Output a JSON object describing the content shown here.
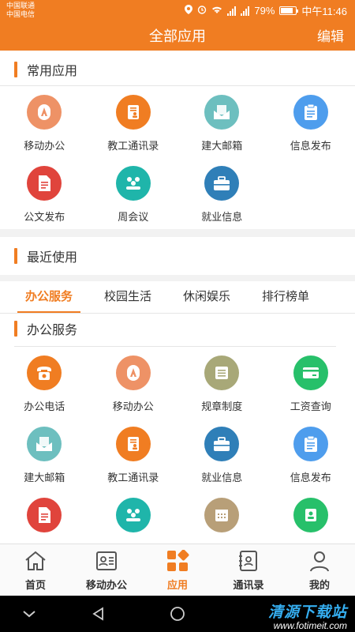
{
  "status_bar": {
    "carrier1": "中国联通",
    "carrier2": "中国电信",
    "battery": "79%",
    "time": "中午11:46"
  },
  "header": {
    "title": "全部应用",
    "edit": "编辑"
  },
  "common_apps": {
    "title": "常用应用",
    "items": [
      {
        "label": "移动办公",
        "icon": "mobile-office-icon",
        "color": "#ee9266"
      },
      {
        "label": "教工通讯录",
        "icon": "contacts-book-icon",
        "color": "#f07d22"
      },
      {
        "label": "建大邮箱",
        "icon": "mail-icon",
        "color": "#6dbfbf"
      },
      {
        "label": "信息发布",
        "icon": "clipboard-icon",
        "color": "#4e9ded"
      },
      {
        "label": "公文发布",
        "icon": "document-icon",
        "color": "#e0443c"
      },
      {
        "label": "周会议",
        "icon": "meeting-icon",
        "color": "#1fb5aa"
      },
      {
        "label": "就业信息",
        "icon": "briefcase-icon",
        "color": "#2f7fb8"
      }
    ]
  },
  "recent": {
    "title": "最近使用"
  },
  "tabs": [
    {
      "label": "办公服务"
    },
    {
      "label": "校园生活"
    },
    {
      "label": "休闲娱乐"
    },
    {
      "label": "排行榜单"
    }
  ],
  "office_services": {
    "title": "办公服务",
    "items": [
      {
        "label": "办公电话",
        "icon": "phone-icon",
        "color": "#f07d22"
      },
      {
        "label": "移动办公",
        "icon": "mobile-office-icon",
        "color": "#ee9266"
      },
      {
        "label": "规章制度",
        "icon": "list-icon",
        "color": "#a8a878"
      },
      {
        "label": "工资查询",
        "icon": "card-icon",
        "color": "#27c06a"
      },
      {
        "label": "建大邮箱",
        "icon": "mail-icon",
        "color": "#6dbfbf"
      },
      {
        "label": "教工通讯录",
        "icon": "contacts-book-icon",
        "color": "#f07d22"
      },
      {
        "label": "就业信息",
        "icon": "briefcase-icon",
        "color": "#2f7fb8"
      },
      {
        "label": "信息发布",
        "icon": "clipboard-icon",
        "color": "#4e9ded"
      },
      {
        "label": "",
        "icon": "document-icon",
        "color": "#e0443c"
      },
      {
        "label": "",
        "icon": "meeting-icon",
        "color": "#1fb5aa"
      },
      {
        "label": "",
        "icon": "calendar-icon",
        "color": "#b89f78"
      },
      {
        "label": "",
        "icon": "address-book-icon",
        "color": "#27c06a"
      }
    ]
  },
  "bottom_nav": [
    {
      "label": "首页",
      "icon": "home-icon"
    },
    {
      "label": "移动办公",
      "icon": "id-card-icon"
    },
    {
      "label": "应用",
      "icon": "apps-grid-icon",
      "active": true
    },
    {
      "label": "通讯录",
      "icon": "contacts-icon"
    },
    {
      "label": "我的",
      "icon": "user-icon"
    }
  ],
  "watermark": {
    "brand": "清源下载站",
    "url": "www.fotimeit.com"
  }
}
